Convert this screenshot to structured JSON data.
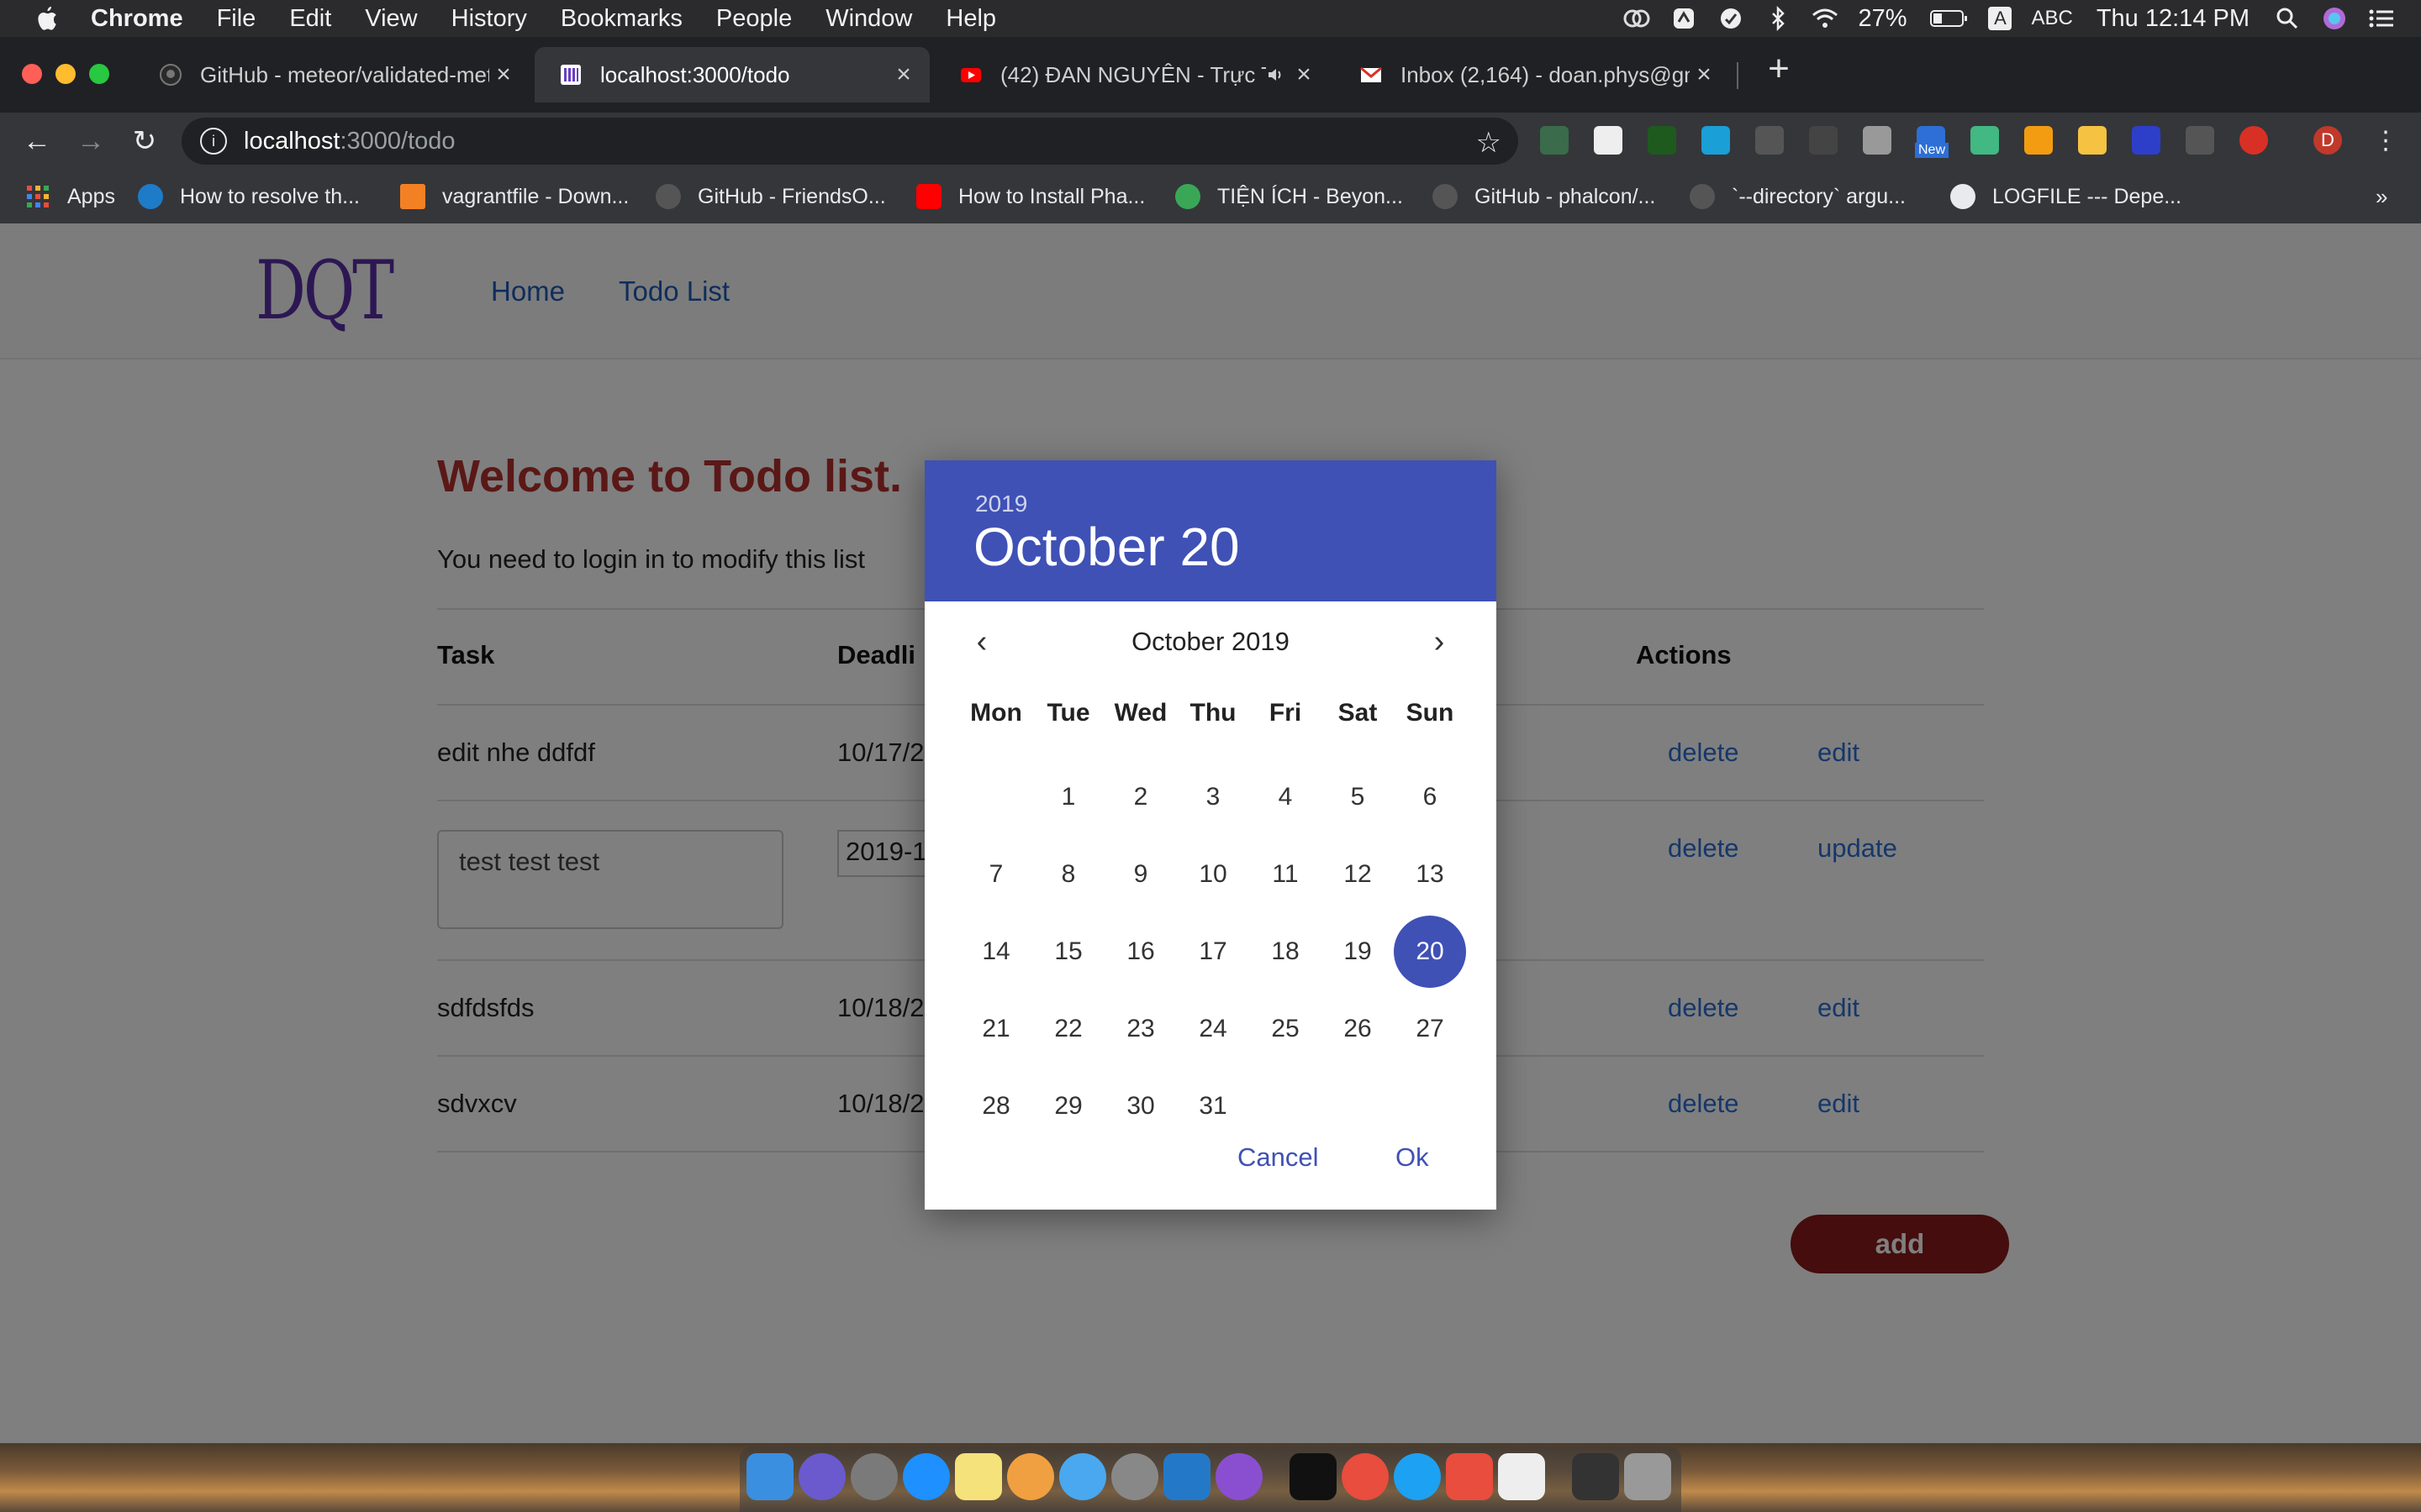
{
  "menubar": {
    "app": "Chrome",
    "items": [
      "File",
      "Edit",
      "View",
      "History",
      "Bookmarks",
      "People",
      "Window",
      "Help"
    ],
    "battery": "27%",
    "input_source": "ABC",
    "clock": "Thu 12:14 PM"
  },
  "tabs": [
    {
      "title": "GitHub - meteor/validated-met",
      "active": false
    },
    {
      "title": "localhost:3000/todo",
      "active": true
    },
    {
      "title": "(42) ĐAN NGUYÊN - Trực T",
      "active": false
    },
    {
      "title": "Inbox (2,164) - doan.phys@gm",
      "active": false
    }
  ],
  "address": {
    "host": "localhost",
    "path": ":3000/todo"
  },
  "bookmarks": [
    "Apps",
    "How to resolve th...",
    "vagrantfile - Down...",
    "GitHub - FriendsO...",
    "How to Install Pha...",
    "TIỆN ÍCH - Beyon...",
    "GitHub - phalcon/...",
    "`--directory` argu...",
    "LOGFILE --- Depe..."
  ],
  "extension_badge": "New",
  "profile_initial": "D",
  "site": {
    "logo": "DQT",
    "nav": [
      "Home",
      "Todo List"
    ],
    "welcome": "Welcome to Todo list.",
    "login_message": "You need to login in to modify this list",
    "columns": {
      "task": "Task",
      "deadline": "Deadli",
      "actions": "Actions"
    },
    "rows": [
      {
        "task": "edit nhe ddfdf",
        "deadline": "10/17/2",
        "delete": "delete",
        "edit": "edit"
      },
      {
        "task": "test test test",
        "deadline": "2019-1",
        "delete": "delete",
        "edit": "update"
      },
      {
        "task": "sdfdsfds",
        "deadline": "10/18/2",
        "delete": "delete",
        "edit": "edit"
      },
      {
        "task": "sdvxcv",
        "deadline": "10/18/2",
        "delete": "delete",
        "edit": "edit"
      }
    ],
    "add_button": "add"
  },
  "datepicker": {
    "year": "2019",
    "selected_date": "October 20",
    "month_label": "October 2019",
    "weekdays": [
      "Mon",
      "Tue",
      "Wed",
      "Thu",
      "Fri",
      "Sat",
      "Sun"
    ],
    "first_weekday_index": 1,
    "days_in_month": 31,
    "selected_day": 20,
    "cancel": "Cancel",
    "ok": "Ok",
    "accent_color": "#3f51b5"
  }
}
